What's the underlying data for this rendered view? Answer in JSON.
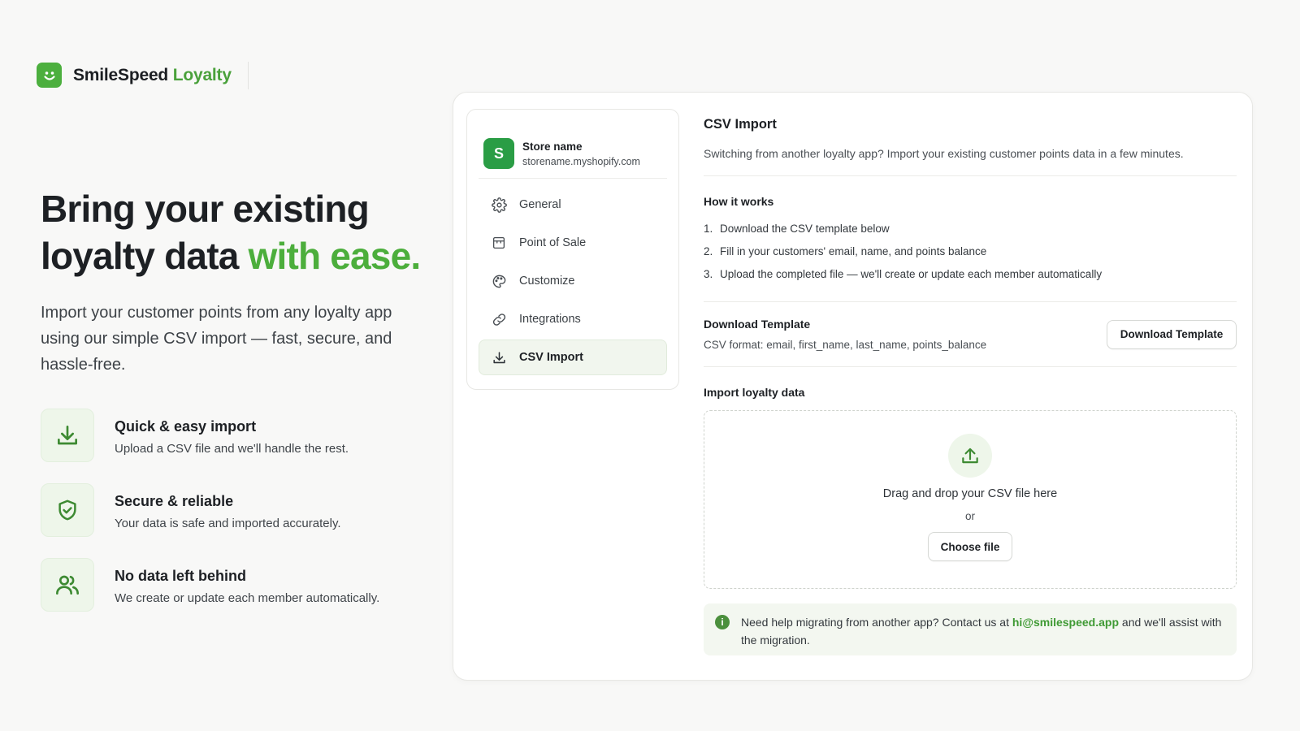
{
  "brand": {
    "name_primary": "SmileSpeed",
    "name_accent": "Loyalty",
    "logo_icon": "smile-face-icon",
    "accent_color": "#4cae3c"
  },
  "hero": {
    "title_line1": "Bring your existing",
    "title_line2_plain": "loyalty data",
    "title_line2_accent": "with ease.",
    "subtitle": "Import your customer points from any loyalty app using our simple CSV import — fast, secure, and hassle-free."
  },
  "features": [
    {
      "icon": "download-icon",
      "title": "Quick & easy import",
      "desc": "Upload a CSV file and we'll handle the rest."
    },
    {
      "icon": "shield-check-icon",
      "title": "Secure & reliable",
      "desc": "Your data is safe and imported accurately."
    },
    {
      "icon": "users-icon",
      "title": "No data left behind",
      "desc": "We create or update each member automatically."
    }
  ],
  "store": {
    "avatar_letter": "S",
    "name": "Store name",
    "domain": "storename.myshopify.com"
  },
  "nav": {
    "items": [
      {
        "icon": "gear-icon",
        "label": "General"
      },
      {
        "icon": "store-icon",
        "label": "Point of Sale"
      },
      {
        "icon": "palette-icon",
        "label": "Customize"
      },
      {
        "icon": "link-icon",
        "label": "Integrations"
      },
      {
        "icon": "download-icon",
        "label": "CSV Import",
        "active": true
      }
    ]
  },
  "content": {
    "title": "CSV Import",
    "subtitle": "Switching from another loyalty app? Import your existing customer points data in a few minutes.",
    "how_title": "How it works",
    "steps": [
      {
        "num": "1.",
        "text": "Download the CSV template below"
      },
      {
        "num": "2.",
        "text": "Fill in your customers' email, name, and points balance"
      },
      {
        "num": "3.",
        "text": "Upload the completed file — we'll create or update each member automatically"
      }
    ],
    "template_title": "Download Template",
    "template_desc": "CSV format: email, first_name, last_name, points_balance",
    "template_button": "Download Template",
    "import_title": "Import loyalty data",
    "drop_text": "Drag and drop your CSV file here",
    "drop_or": "or",
    "choose_button": "Choose file",
    "help_before": "Need help migrating from another app? Contact us at ",
    "help_email": "hi@smilespeed.app",
    "help_after": " and we'll assist with the migration."
  }
}
